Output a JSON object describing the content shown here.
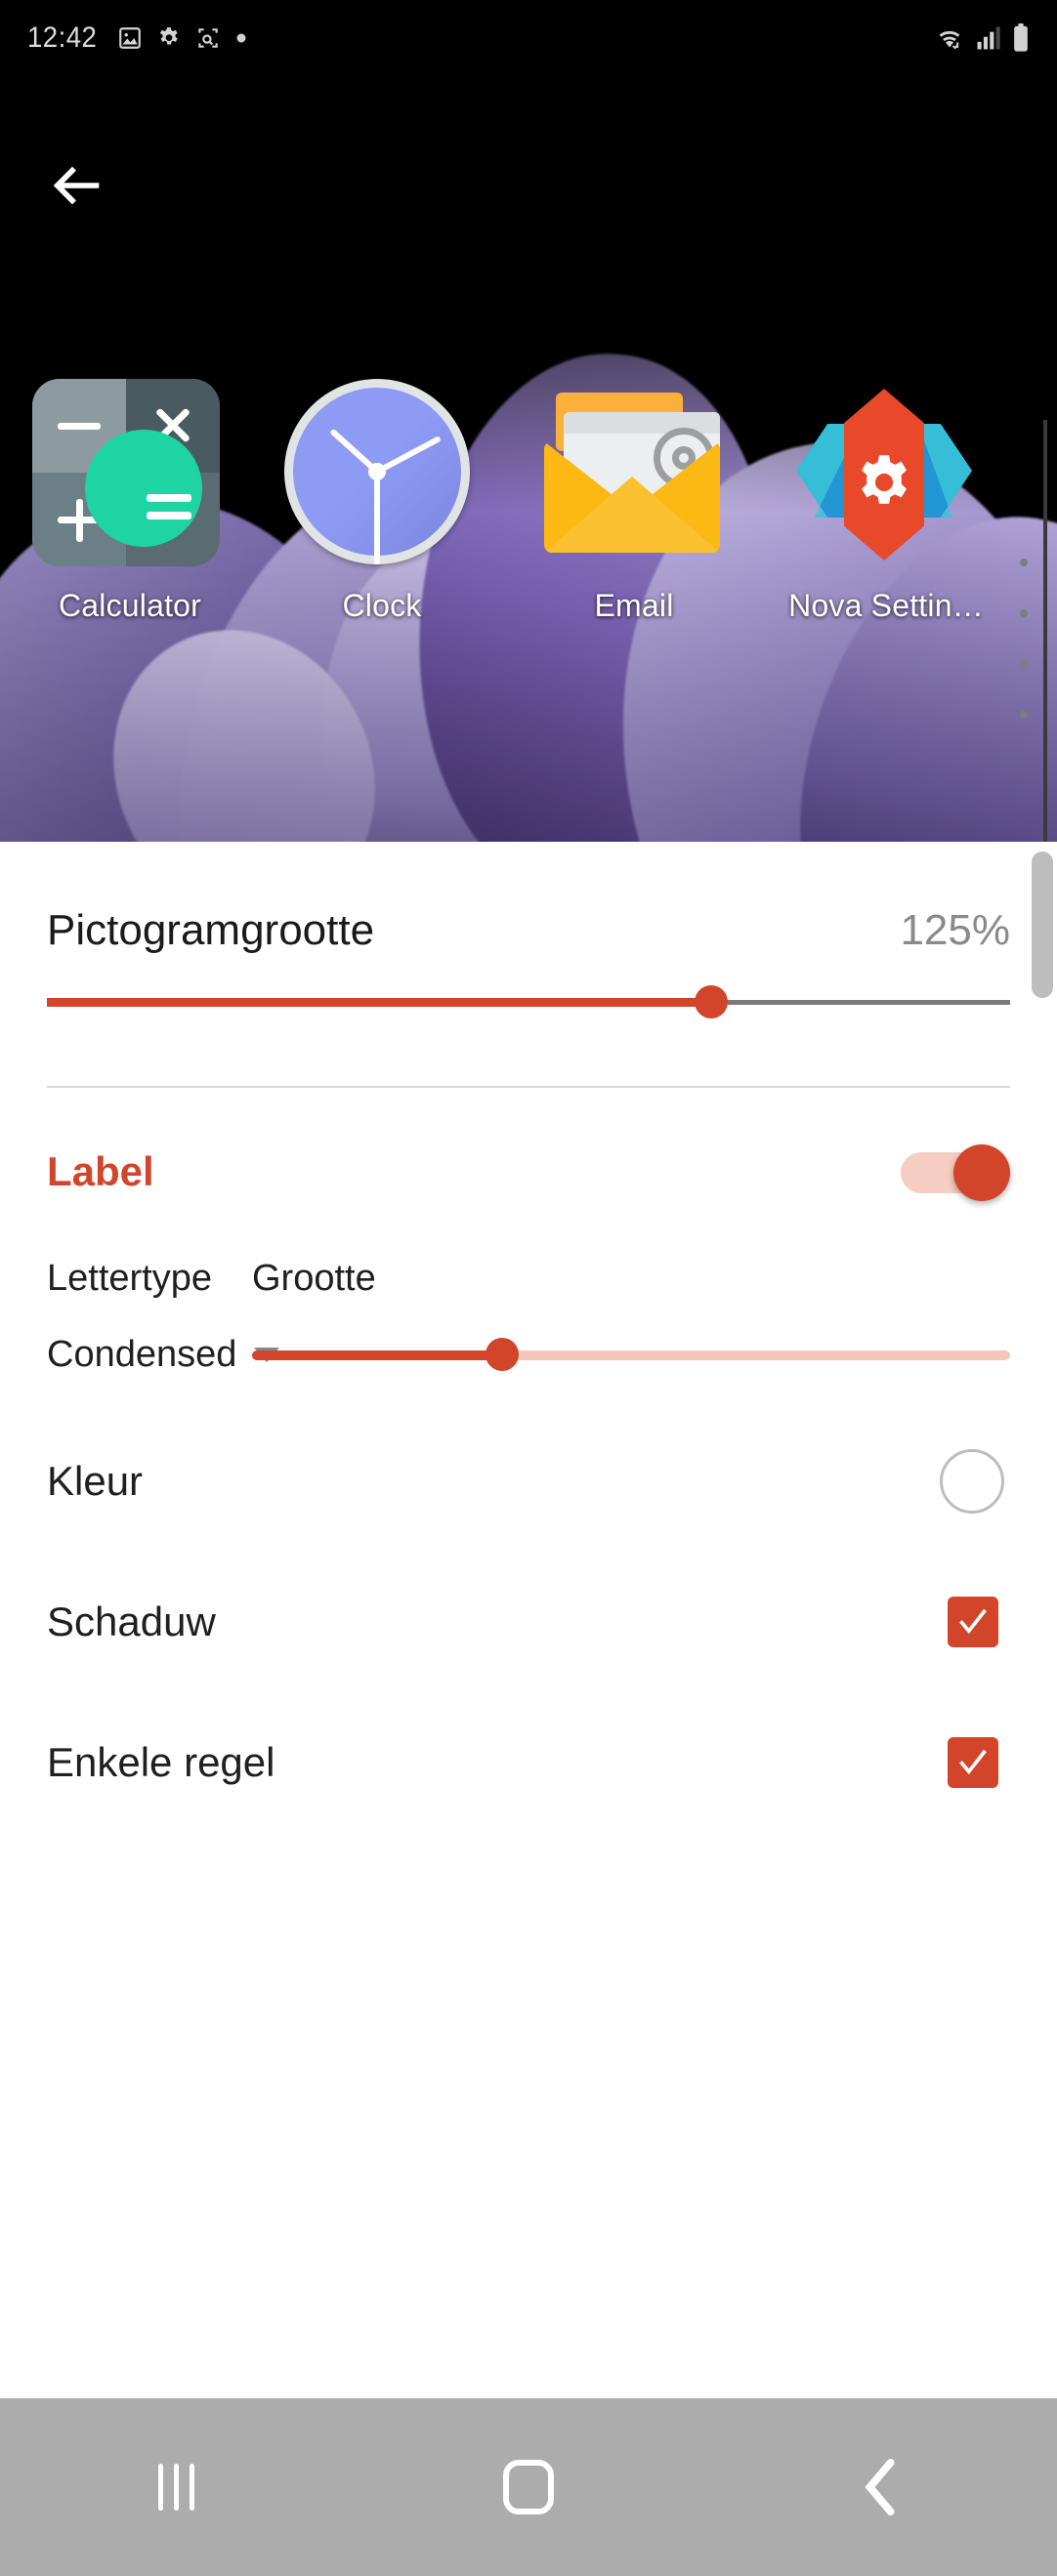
{
  "status_bar": {
    "time": "12:42",
    "left_icons": [
      "image-icon",
      "gear-icon",
      "screenshot-icon",
      "dot-icon"
    ],
    "right_icons": [
      "wifi-icon",
      "signal-icon",
      "battery-icon"
    ]
  },
  "preview": {
    "back_icon": "back-arrow-icon",
    "apps": [
      {
        "label": "Calculator",
        "icon": "calculator-icon"
      },
      {
        "label": "Clock",
        "icon": "clock-icon"
      },
      {
        "label": "Email",
        "icon": "email-icon"
      },
      {
        "label": "Nova Settin…",
        "icon": "nova-settings-icon"
      }
    ],
    "page_dots": 4
  },
  "settings": {
    "icon_size": {
      "title": "Pictogramgrootte",
      "value": "125%",
      "percent": 69
    },
    "label": {
      "title": "Label",
      "enabled": true
    },
    "font": {
      "font_header": "Lettertype",
      "size_header": "Grootte",
      "font_value": "Condensed",
      "dropdown_icon": "chevron-down-icon",
      "size_percent": 33
    },
    "options": [
      {
        "label": "Kleur",
        "control": "color-swatch",
        "value": "#ffffff",
        "checked": null
      },
      {
        "label": "Schaduw",
        "control": "checkbox",
        "value": "",
        "checked": true
      },
      {
        "label": "Enkele regel",
        "control": "checkbox",
        "value": "",
        "checked": true
      }
    ]
  },
  "nav_bar": {
    "recents_icon": "recents-icon",
    "home_icon": "home-icon",
    "back_icon": "back-icon"
  },
  "colors": {
    "accent": "#d2452a",
    "accent_soft": "#f5c6bb",
    "sheet_bg": "#ffffff",
    "nav_bg": "#acacac",
    "status_bg": "#000000"
  }
}
